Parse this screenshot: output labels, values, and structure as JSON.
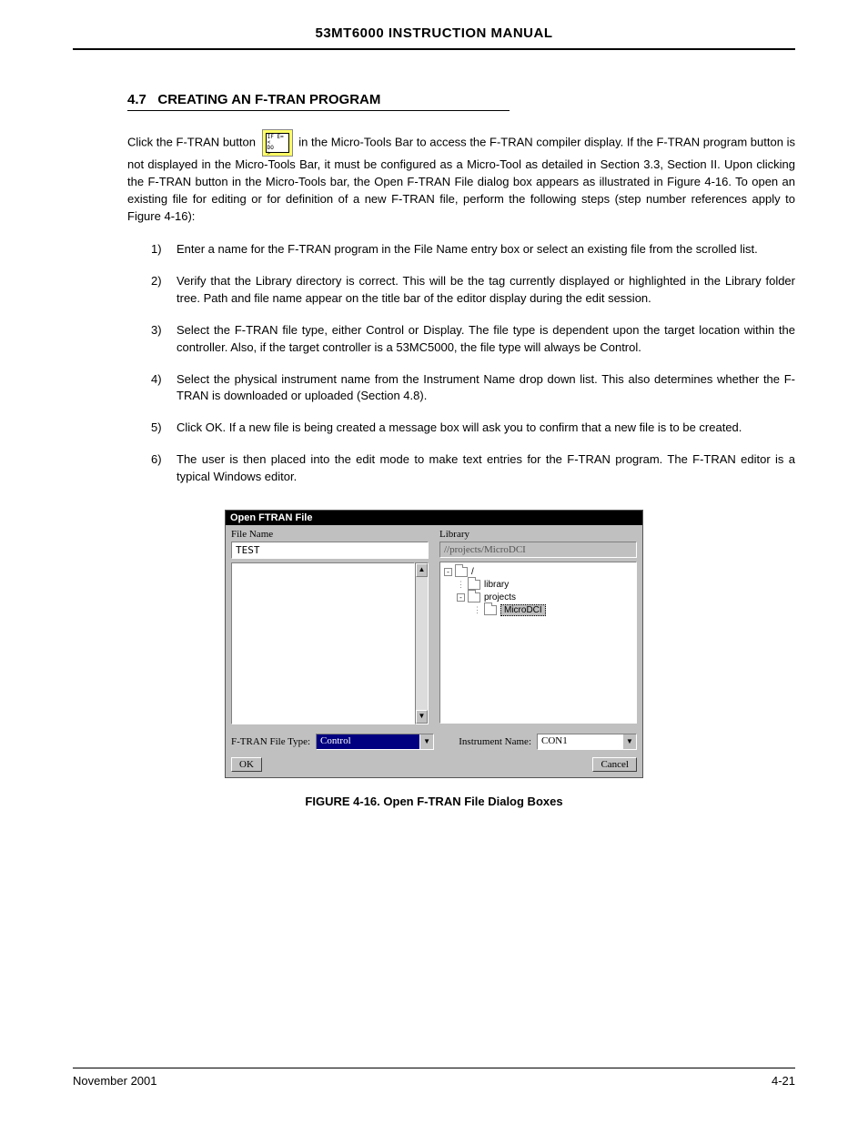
{
  "header": {
    "title": "53MT6000 INSTRUCTION MANUAL"
  },
  "section": {
    "number": "4.7",
    "title": "CREATING AN F-TRAN PROGRAM",
    "p1_before_icon": "Click the F-TRAN button ",
    "p1_after_icon": " in the Micro-Tools Bar to access the F-TRAN compiler display. If the F-TRAN program button is not displayed in the Micro-Tools Bar, it must be configured as a Micro-Tool as detailed in Section 3.3, Section II. Upon clicking the F-TRAN button in the Micro-Tools bar, the Open F-TRAN File dialog box appears as illustrated in Figure 4-16. To open an existing file for editing or for definition of a new F-TRAN file, perform the following steps (step number references apply to Figure 4-16):",
    "icon_text": "IF E=\n<\nDO\n>",
    "steps": [
      "Enter a name for the F-TRAN program in the File Name entry box or select an existing file from the scrolled list.",
      "Verify that the Library directory is correct. This will be the tag currently displayed or highlighted in the Library folder tree. Path and file name appear on the title bar of the editor display during the edit session.",
      "Select the F-TRAN file type, either Control or Display. The file type is dependent upon the target location within the controller. Also, if the target controller is a 53MC5000, the file type will always be Control.",
      "Select the physical instrument name from the Instrument Name drop down list. This also determines whether the F-TRAN is downloaded or uploaded (Section 4.8).",
      "Click OK.  If a new file is being created a message box will ask you to confirm that a new file is to be created.",
      "The user is then placed into the edit mode to make text entries for the F-TRAN program. The F-TRAN editor is a typical Windows editor."
    ]
  },
  "dialog": {
    "title": "Open FTRAN File",
    "fileNameLabel": "File Name",
    "fileNameValue": "TEST",
    "libraryLabel": "Library",
    "libraryPath": "//projects/MicroDCI",
    "tree": {
      "root": "/",
      "items": [
        "library",
        "projects"
      ],
      "selected": "MicroDCI"
    },
    "fileTypeLabel": "F-TRAN File Type:",
    "fileTypeValue": "Control",
    "instrNameLabel": "Instrument Name:",
    "instrNameValue": "CON1",
    "ok": "OK",
    "cancel": "Cancel"
  },
  "figure": {
    "caption": "FIGURE 4-16.  Open F-TRAN File Dialog Boxes"
  },
  "footer": {
    "left": "November 2001",
    "right": "4-21"
  }
}
